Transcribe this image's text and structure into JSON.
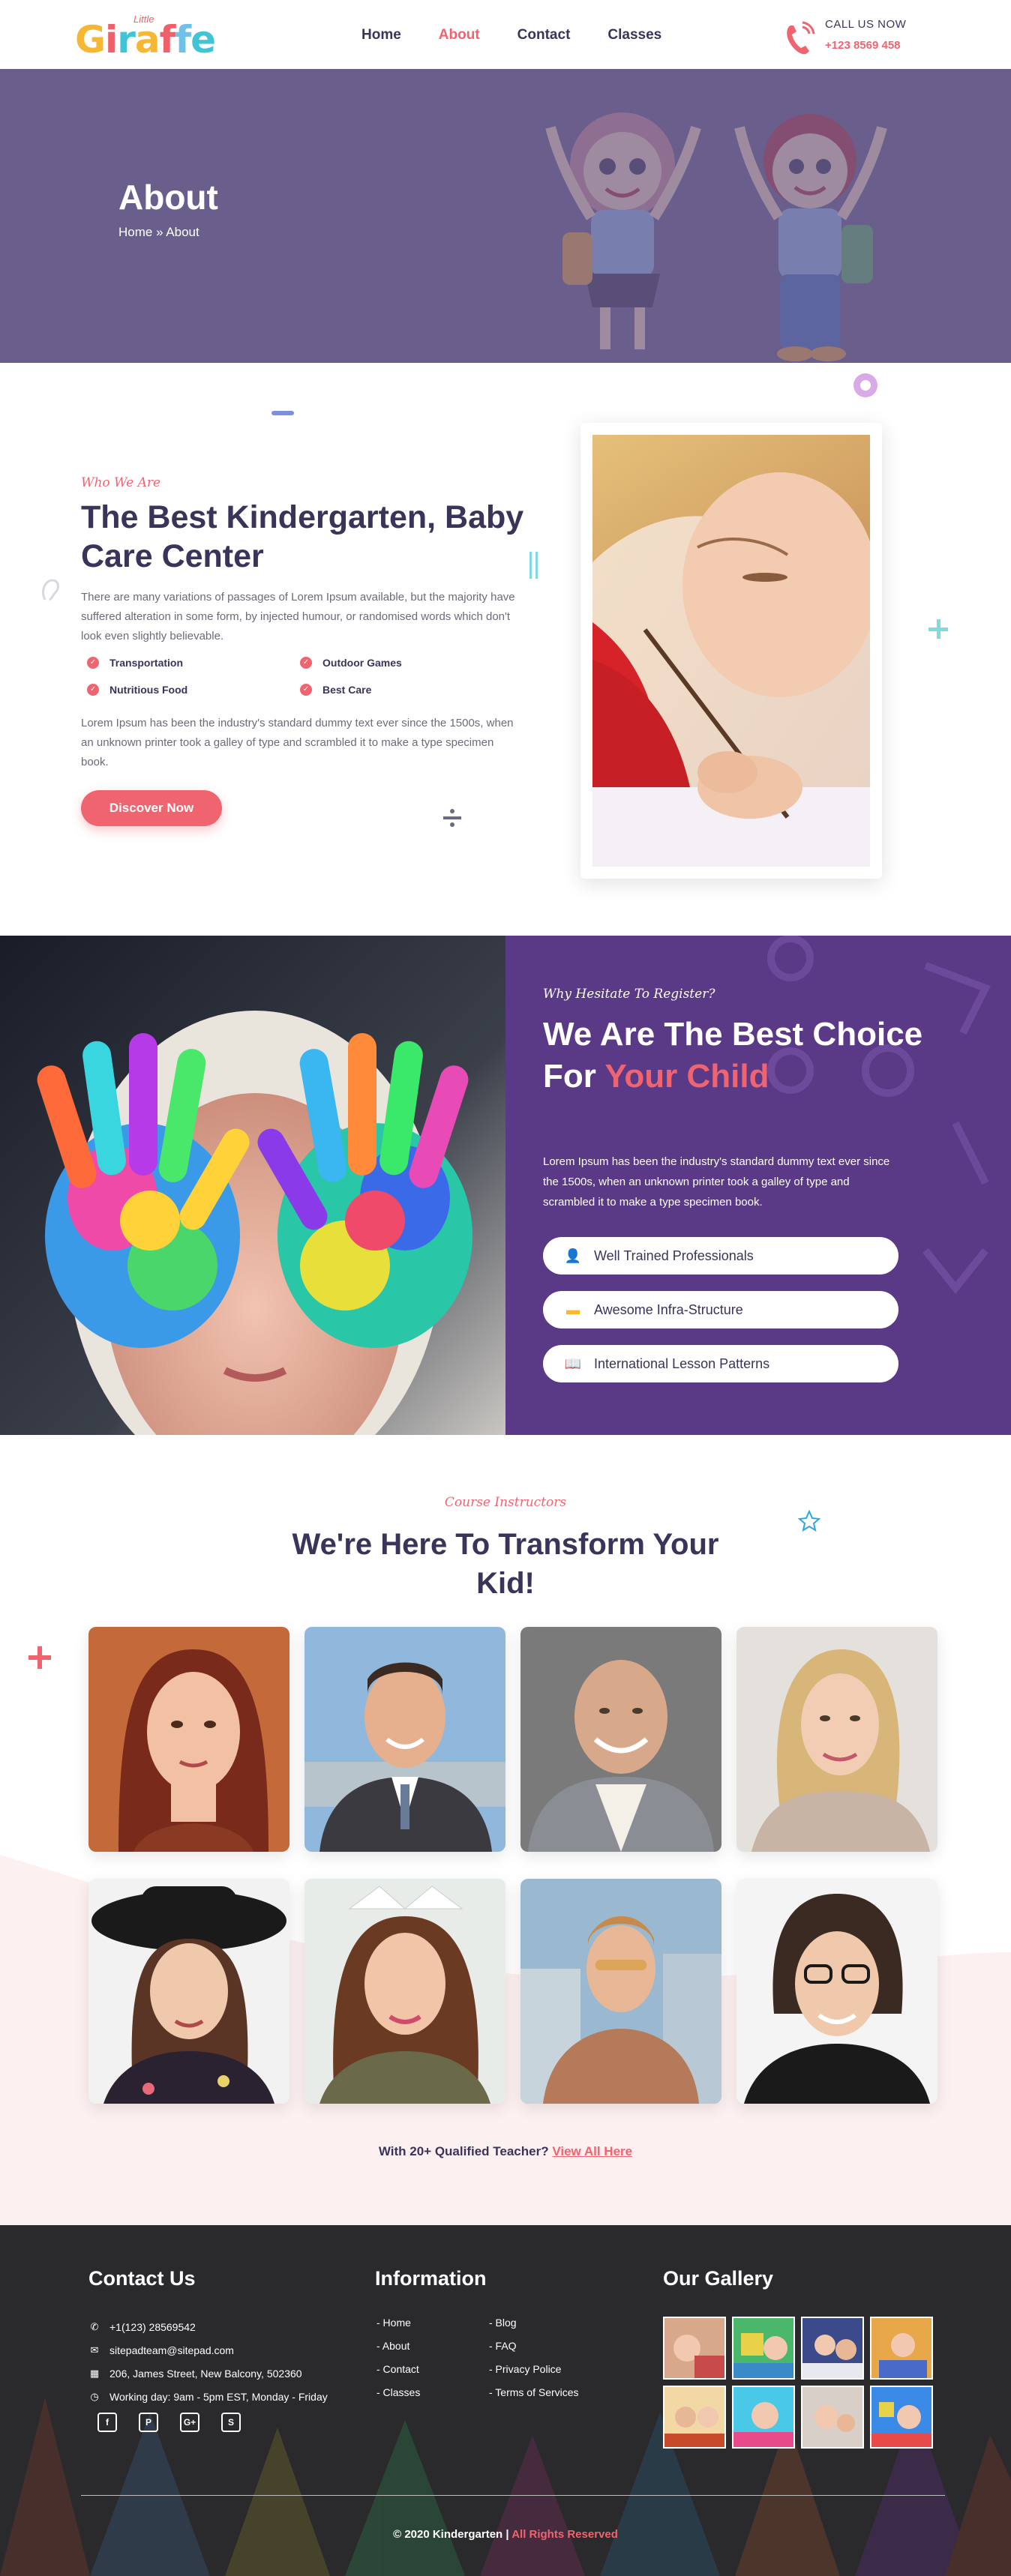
{
  "header": {
    "logo": {
      "small": "Little",
      "main_letters": [
        "G",
        "i",
        "r",
        "a",
        "f",
        "f",
        "e"
      ],
      "main": "Giraffe"
    },
    "nav": [
      {
        "label": "Home",
        "active": false
      },
      {
        "label": "About",
        "active": true
      },
      {
        "label": "Contact",
        "active": false
      },
      {
        "label": "Classes",
        "active": false
      }
    ],
    "call_label": "CALL US NOW",
    "call_number": "+123 8569 458"
  },
  "hero": {
    "title": "About",
    "breadcrumb": "Home » About",
    "background_color": "#6a5f8c"
  },
  "about": {
    "eyebrow": "Who We Are",
    "title": "The Best Kindergarten, Baby Care Center",
    "paragraph1": "There are many variations of passages of Lorem Ipsum available, but the majority have suffered alteration in some form, by injected humour, or randomised words which don't look even slightly believable.",
    "features": [
      "Transportation",
      "Outdoor Games",
      "Nutritious Food",
      "Best Care"
    ],
    "paragraph2": "Lorem Ipsum has been the industry's standard dummy text ever since the 1500s, when an unknown printer took a galley of type and scrambled it to make a type specimen book.",
    "button": "Discover Now"
  },
  "register": {
    "eyebrow": "Why Hesitate To Register?",
    "title_part1": "We Are The Best Choice For ",
    "title_highlight": "Your Child",
    "paragraph": "Lorem Ipsum has been the industry's standard dummy text ever since the 1500s, when an unknown printer took a galley of type and scrambled it to make a type specimen book.",
    "items": [
      {
        "icon": "user-icon",
        "label": "Well Trained Professionals"
      },
      {
        "icon": "bed-icon",
        "label": "Awesome Infra-Structure"
      },
      {
        "icon": "book-icon",
        "label": "International Lesson Patterns"
      }
    ],
    "panel_color": "#5a3a86"
  },
  "instructors": {
    "eyebrow": "Course Instructors",
    "title": "We're Here To Transform Your Kid!",
    "more_text": "With 20+ Qualified Teacher? ",
    "more_link": "View All Here"
  },
  "footer": {
    "contact_heading": "Contact Us",
    "contacts": [
      {
        "icon": "phone-icon",
        "text": "+1(123) 28569542"
      },
      {
        "icon": "mail-icon",
        "text": "sitepadteam@sitepad.com"
      },
      {
        "icon": "map-icon",
        "text": "206, James Street, New Balcony, 502360"
      },
      {
        "icon": "clock-icon",
        "text": "Working day: 9am - 5pm EST, Monday - Friday"
      }
    ],
    "socials": [
      "facebook-icon",
      "pinterest-icon",
      "google-plus-icon",
      "skype-icon"
    ],
    "social_glyphs": [
      "f",
      "P",
      "G+",
      "S"
    ],
    "info_heading": "Information",
    "info_col1": [
      "- Home",
      "- About",
      "- Contact",
      "- Classes"
    ],
    "info_col2": [
      "- Blog",
      "- FAQ",
      "- Privacy Police",
      "- Terms of Services"
    ],
    "gallery_heading": "Our Gallery",
    "copy_main": "© 2020 Kindergarten | ",
    "copy_highlight": "All Rights Reserved"
  },
  "colors": {
    "accent": "#f06470",
    "navy": "#3b3359",
    "purple": "#5a3a86",
    "footer": "#2a2a2c"
  }
}
